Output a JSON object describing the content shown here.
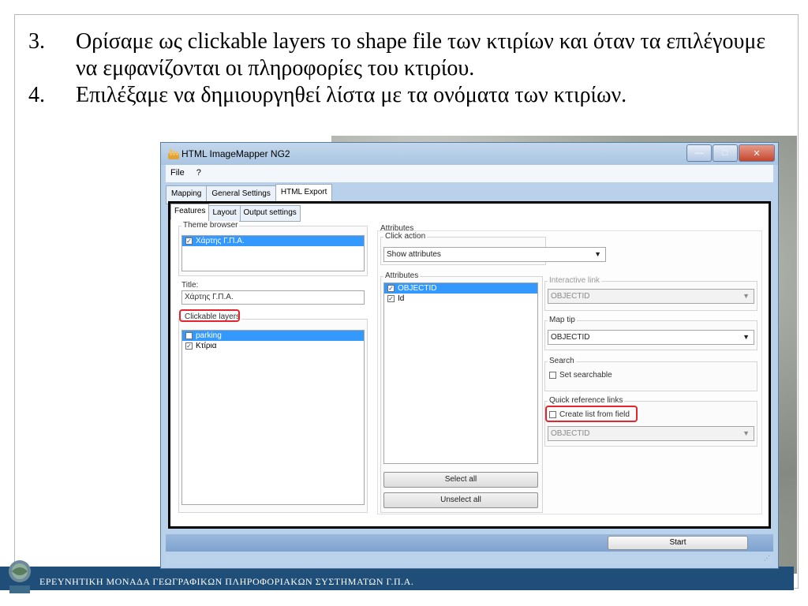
{
  "slide": {
    "bullets": [
      {
        "num": "3.",
        "text": "Ορίσαμε ως clickable layers το shape file των κτιρίων και όταν τα επιλέγουμε να εμφανίζονται οι πληροφορίες του κτιρίου."
      },
      {
        "num": "4.",
        "text": "Επιλέξαμε να δημιουργηθεί λίστα με τα ονόματα των κτιρίων."
      }
    ],
    "footer_text": "ΕΡΕΥΝΗΤΙΚΗ ΜΟΝΑΔΑ ΓΕΩΓΡΑΦΙΚΩΝ ΠΛΗΡΟΦΟΡΙΑΚΩΝ ΣΥΣΤΗΜΑΤΩΝ Γ.Π.Α.",
    "footer_color": "#1f4e79",
    "logo_icon": "globe-logo-icon"
  },
  "window": {
    "title": "HTML ImageMapper NG2",
    "menu": [
      "File",
      "?"
    ],
    "main_tabs": [
      "Mapping",
      "General Settings",
      "HTML Export"
    ],
    "active_main_tab": "HTML Export",
    "sub_tabs": [
      "Features",
      "Layout",
      "Output settings"
    ],
    "active_sub_tab": "Features",
    "start_label": "Start"
  },
  "left": {
    "theme_browser_label": "Theme browser",
    "theme_items": [
      {
        "label": "Χάρτης Γ.Π.Α.",
        "checked": true,
        "selected": true
      }
    ],
    "title_label": "Title:",
    "title_value": "Χάρτης Γ.Π.Α.",
    "clickable_layers_label": "Clickable layers",
    "layers": [
      {
        "label": "parking",
        "checked": false,
        "selected": true
      },
      {
        "label": "Κτίρια",
        "checked": true,
        "selected": false
      }
    ]
  },
  "middle": {
    "attributes_group_label": "Attributes",
    "click_action_label": "Click action",
    "click_action_value": "Show attributes",
    "attributes_label": "Attributes",
    "attributes": [
      {
        "label": "OBJECTID",
        "checked": true,
        "selected": true
      },
      {
        "label": "Id",
        "checked": true,
        "selected": false
      }
    ],
    "select_all_label": "Select all",
    "unselect_all_label": "Unselect all"
  },
  "right": {
    "interactive_link_label": "Interactive link",
    "interactive_link_value": "OBJECTID",
    "map_tip_label": "Map tip",
    "map_tip_value": "OBJECTID",
    "search_label": "Search",
    "set_searchable_label": "Set searchable",
    "quick_ref_label": "Quick reference links",
    "create_list_label": "Create list from field",
    "quick_ref_value": "OBJECTID"
  },
  "highlight_color": "#e3262d"
}
